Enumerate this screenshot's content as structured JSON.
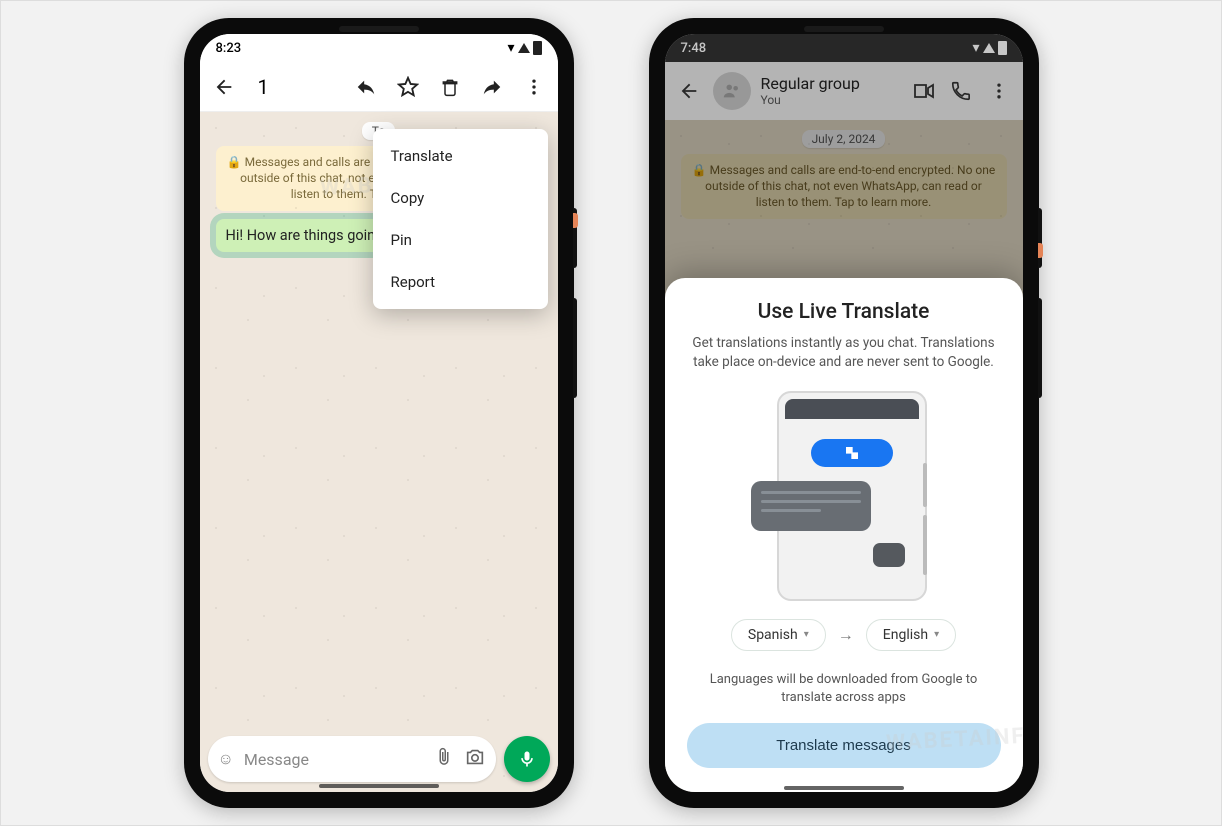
{
  "phone1": {
    "time": "8:23",
    "selected_count": "1",
    "date_label": "To",
    "encryption_text": "🔒 Messages and calls are end-to-end encrypted. No one outside of this chat, not even WhatsApp, can read or listen to them. Tap to learn more.",
    "message_text": "Hi! How are things going?",
    "composer_placeholder": "Message",
    "menu": {
      "translate": "Translate",
      "copy": "Copy",
      "pin": "Pin",
      "report": "Report"
    }
  },
  "phone2": {
    "time": "7:48",
    "group_name": "Regular group",
    "group_sub": "You",
    "date_label": "July 2, 2024",
    "encryption_text": "🔒 Messages and calls are end-to-end encrypted. No one outside of this chat, not even WhatsApp, can read or listen to them. Tap to learn more.",
    "sheet": {
      "title": "Use Live Translate",
      "desc": "Get translations instantly as you chat. Translations take place on-device and are never sent to Google.",
      "lang_from": "Spanish",
      "lang_to": "English",
      "download_note": "Languages will be downloaded from Google to translate across apps",
      "button": "Translate messages"
    }
  },
  "watermark": "WABETAINFO"
}
